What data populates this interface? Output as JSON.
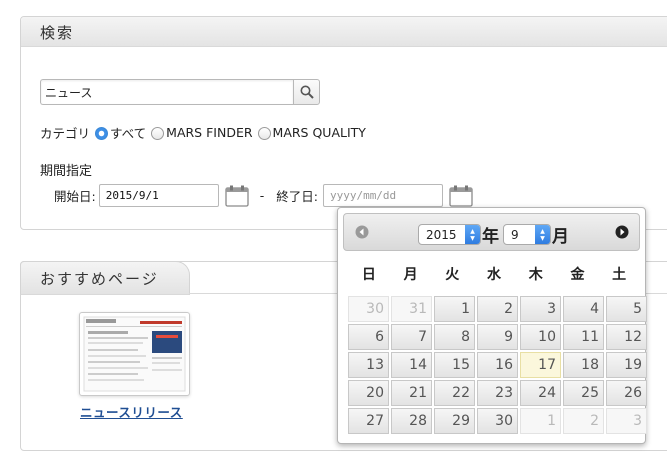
{
  "search_panel": {
    "title": "検索",
    "query_value": "ニュース",
    "category_label": "カテゴリ",
    "categories": [
      {
        "label": "すべて",
        "selected": true
      },
      {
        "label": "MARS FINDER",
        "selected": false
      },
      {
        "label": "MARS QUALITY",
        "selected": false
      }
    ],
    "period_title": "期間指定",
    "start_label": "開始日:",
    "start_value": "2015/9/1",
    "separator": "-",
    "end_label": "終了日:",
    "end_placeholder": "yyyy/mm/dd"
  },
  "recommended": {
    "title": "おすすめページ",
    "link_label": "ニュースリリース"
  },
  "datepicker": {
    "year": "2015",
    "year_suffix": "年",
    "month": "9",
    "month_suffix": "月",
    "weekdays": [
      "日",
      "月",
      "火",
      "水",
      "木",
      "金",
      "土"
    ],
    "days": [
      {
        "d": "30",
        "other": true
      },
      {
        "d": "31",
        "other": true
      },
      {
        "d": "1"
      },
      {
        "d": "2"
      },
      {
        "d": "3"
      },
      {
        "d": "4"
      },
      {
        "d": "5"
      },
      {
        "d": "6"
      },
      {
        "d": "7"
      },
      {
        "d": "8"
      },
      {
        "d": "9"
      },
      {
        "d": "10"
      },
      {
        "d": "11"
      },
      {
        "d": "12"
      },
      {
        "d": "13"
      },
      {
        "d": "14"
      },
      {
        "d": "15"
      },
      {
        "d": "16"
      },
      {
        "d": "17",
        "today": true
      },
      {
        "d": "18"
      },
      {
        "d": "19"
      },
      {
        "d": "20"
      },
      {
        "d": "21"
      },
      {
        "d": "22"
      },
      {
        "d": "23"
      },
      {
        "d": "24"
      },
      {
        "d": "25"
      },
      {
        "d": "26"
      },
      {
        "d": "27"
      },
      {
        "d": "28"
      },
      {
        "d": "29"
      },
      {
        "d": "30"
      },
      {
        "d": "1",
        "other": true
      },
      {
        "d": "2",
        "other": true
      },
      {
        "d": "3",
        "other": true
      }
    ]
  },
  "colors": {
    "accent": "#3d8fe6",
    "link": "#1f4e93",
    "today_bg": "#fbf7dc"
  },
  "icons": [
    "search-icon",
    "calendar-icon",
    "prev-month-icon",
    "next-month-icon"
  ]
}
